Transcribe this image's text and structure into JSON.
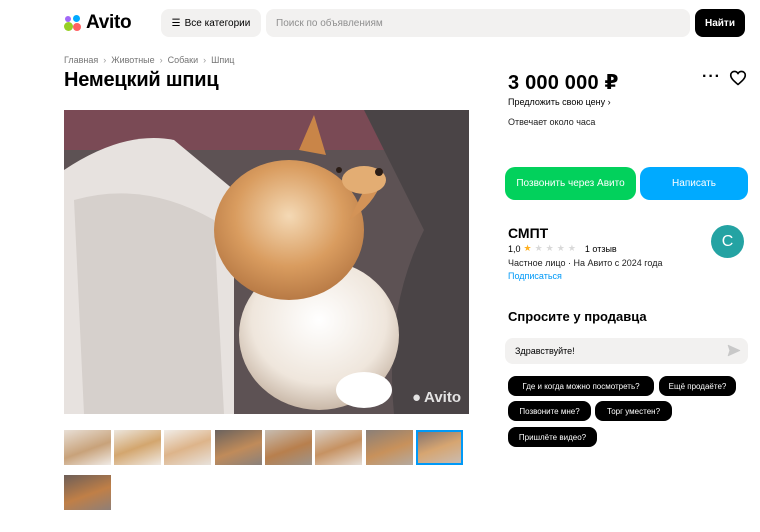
{
  "header": {
    "logo_text": "Avito",
    "categories_label": "Все категории",
    "search_placeholder": "Поиск по объявлениям",
    "find_label": "Найти"
  },
  "breadcrumbs": [
    "Главная",
    "Животные",
    "Собаки",
    "Шпиц"
  ],
  "listing": {
    "title": "Немецкий шпиц",
    "photo_watermark": "Avito",
    "thumbnail_count": 9,
    "active_thumbnail_index": 7
  },
  "sidebar": {
    "price": "3 000 000 ₽",
    "offer_price_link": "Предложить свою цену ›",
    "reply_time": "Отвечает около часа",
    "call_button": "Позвонить через Авито",
    "write_button": "Написать"
  },
  "seller": {
    "name": "СМПТ",
    "rating_value": "1,0",
    "stars_filled": 1,
    "stars_total": 5,
    "reviews": "1 отзыв",
    "type": "Частное лицо · На Авито с 2024 года",
    "subscribe": "Подписаться",
    "avatar_letter": "С",
    "avatar_color": "#24a3a3"
  },
  "ask": {
    "title": "Спросите у продавца",
    "message_value": "Здравствуйте!",
    "quick_questions": [
      "Где и когда можно посмотреть?",
      "Ещё продаёте?",
      "Позвоните мне?",
      "Торг уместен?",
      "Пришлёте видео?"
    ]
  },
  "colors": {
    "call_button": "#02d15c",
    "write_button": "#00aaff",
    "link": "#0099f7",
    "star": "#ffb021"
  }
}
